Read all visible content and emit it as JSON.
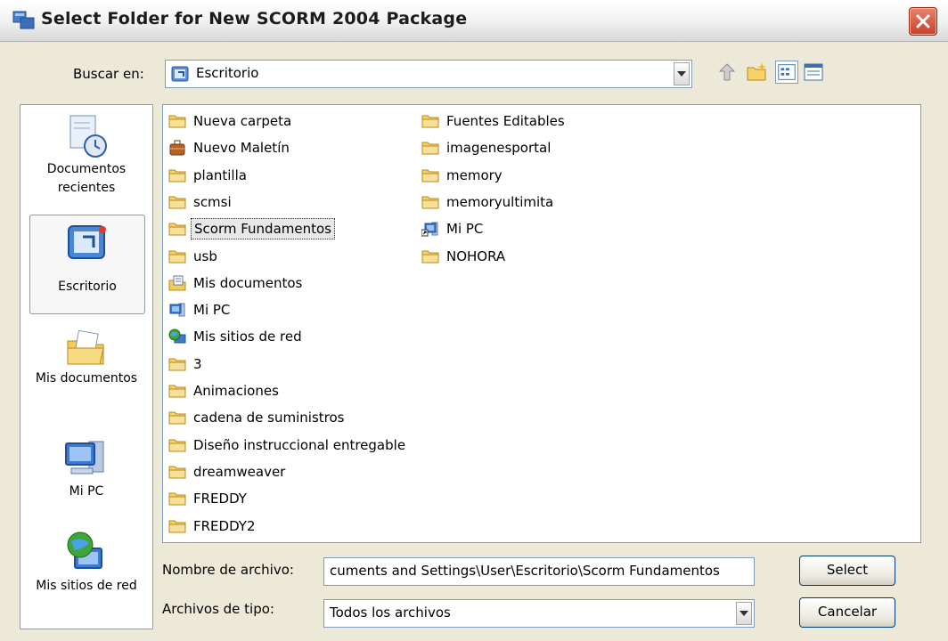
{
  "window": {
    "title": "Select Folder for New SCORM 2004 Package"
  },
  "lookin": {
    "label": "Buscar en:",
    "value": "Escritorio"
  },
  "places": [
    {
      "label": "Documentos recientes",
      "icon": "recent-documents-icon"
    },
    {
      "label": "Escritorio",
      "icon": "desktop-icon"
    },
    {
      "label": "Mis documentos",
      "icon": "my-documents-icon"
    },
    {
      "label": "Mi PC",
      "icon": "my-computer-icon"
    },
    {
      "label": "Mis sitios de red",
      "icon": "network-places-icon"
    }
  ],
  "files": {
    "col1": [
      {
        "name": "Nueva carpeta",
        "icon": "folder-icon"
      },
      {
        "name": "Nuevo Maletín",
        "icon": "briefcase-icon"
      },
      {
        "name": "plantilla",
        "icon": "folder-icon"
      },
      {
        "name": "scmsi",
        "icon": "folder-icon"
      },
      {
        "name": "Scorm Fundamentos",
        "icon": "folder-icon",
        "selected": true
      },
      {
        "name": "usb",
        "icon": "folder-icon"
      },
      {
        "name": "Mis documentos",
        "icon": "my-documents-icon"
      },
      {
        "name": "Mi PC",
        "icon": "my-computer-icon"
      },
      {
        "name": "Mis sitios de red",
        "icon": "network-places-icon"
      },
      {
        "name": "3",
        "icon": "folder-icon"
      },
      {
        "name": "Animaciones",
        "icon": "folder-icon"
      },
      {
        "name": "cadena de suministros",
        "icon": "folder-icon"
      },
      {
        "name": "Diseño instruccional entregable",
        "icon": "folder-icon"
      },
      {
        "name": "dreamweaver",
        "icon": "folder-icon"
      },
      {
        "name": "FREDDY",
        "icon": "folder-icon"
      },
      {
        "name": "FREDDY2",
        "icon": "folder-icon"
      }
    ],
    "col2": [
      {
        "name": "Fuentes Editables",
        "icon": "folder-icon"
      },
      {
        "name": "imagenesportal",
        "icon": "folder-icon"
      },
      {
        "name": "memory",
        "icon": "folder-icon"
      },
      {
        "name": "memoryultimita",
        "icon": "folder-icon"
      },
      {
        "name": "Mi PC",
        "icon": "my-computer-shortcut-icon"
      },
      {
        "name": "NOHORA",
        "icon": "folder-icon"
      }
    ]
  },
  "filename": {
    "label": "Nombre de archivo:",
    "value": "cuments and Settings\\User\\Escritorio\\Scorm Fundamentos"
  },
  "filetype": {
    "label": "Archivos de tipo:",
    "value": "Todos los archivos"
  },
  "buttons": {
    "select": "Select",
    "cancel": "Cancelar"
  },
  "colors": {
    "selection": "#e8e8e8",
    "border": "#7f9db9",
    "dialog": "#ece9d8",
    "close": "#c8402a"
  }
}
